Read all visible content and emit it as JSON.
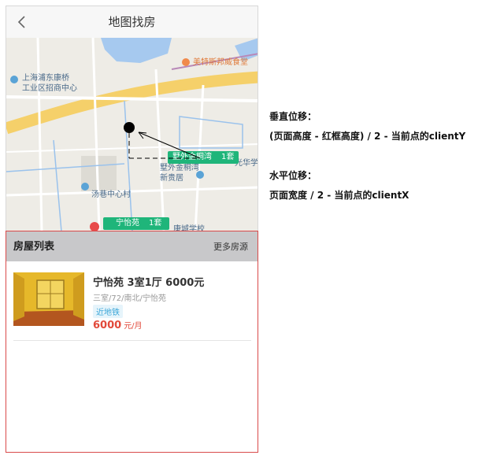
{
  "header": {
    "title": "地图找房"
  },
  "map": {
    "labels": [
      "上海浦东康桥\n工业区招商中心",
      "美特斯邦威食堂",
      "汤巷中心村",
      "康城学校",
      "墅外金桐湾\n新贵居",
      "光华学"
    ],
    "pins": [
      {
        "name": "墅外金桐湾",
        "count": "1套"
      },
      {
        "name": "宁怡苑",
        "count": "1套"
      }
    ]
  },
  "list": {
    "title": "房屋列表",
    "more_label": "更多房源",
    "items": [
      {
        "title": "宁怡苑 3室1厅 6000元",
        "sub": "三室/72/南北/宁怡苑",
        "tag": "近地铁",
        "price": "6000",
        "unit": "元/月"
      }
    ]
  },
  "notes": {
    "vertical_title": "垂直位移：",
    "vertical_formula": "(页面高度 - 红框高度) / 2 - 当前点的clientY",
    "horizontal_title": "水平位移：",
    "horizontal_formula": "页面宽度 / 2 - 当前点的clientX"
  }
}
